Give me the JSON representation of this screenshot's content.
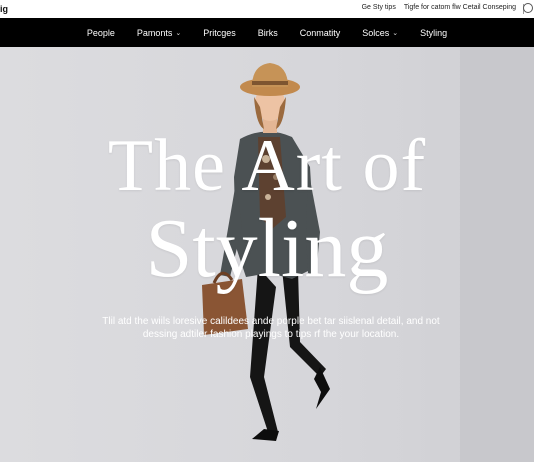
{
  "topbar": {
    "brand": "ig",
    "links": [
      "Ge Sty tips",
      "Tigfe for catom flw Cetail Conseping"
    ]
  },
  "nav": {
    "items": [
      {
        "label": "People",
        "dropdown": false
      },
      {
        "label": "Pamonts",
        "dropdown": true
      },
      {
        "label": "Pritcges",
        "dropdown": false
      },
      {
        "label": "Birks",
        "dropdown": false
      },
      {
        "label": "Conmatity",
        "dropdown": false
      },
      {
        "label": "Solces",
        "dropdown": true
      },
      {
        "label": "Styling",
        "dropdown": false
      }
    ]
  },
  "hero": {
    "headline_line1": "The Art of",
    "headline_line2": "Styling",
    "description": "Tlil atd the wiils loresive calildees ande porple bet tar siislenal detail, and not dessing adtiler fashion playings to tips rf the your location."
  },
  "colors": {
    "nav_bg": "#000000",
    "hero_bg": "#d7d7d9",
    "text_on_hero": "#ffffff"
  }
}
